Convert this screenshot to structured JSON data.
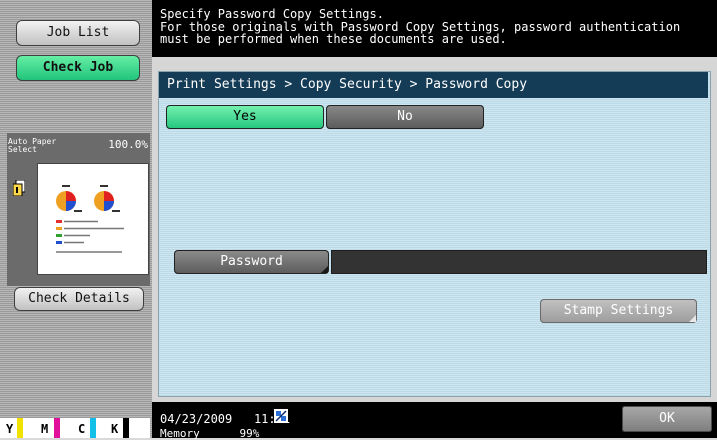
{
  "left": {
    "job_list": "Job List",
    "check_job": "Check Job",
    "paper_label_top": "Auto Paper",
    "paper_label_bottom": "Select",
    "zoom": "100.0%",
    "check_details": "Check Details",
    "toner": [
      "Y",
      "M",
      "C",
      "K"
    ],
    "toner_colors": [
      "#f2e200",
      "#e0109a",
      "#12c0e8",
      "#000000"
    ]
  },
  "header": {
    "message": "Specify Password Copy Settings.\nFor those originals with Password Copy Settings, password authentication\nmust be performed when these documents are used."
  },
  "breadcrumb": "Print Settings > Copy Security > Password Copy",
  "options": {
    "yes": "Yes",
    "no": "No",
    "selected": "Yes"
  },
  "password": {
    "label": "Password",
    "value": ""
  },
  "stamp_settings": "Stamp Settings",
  "status": {
    "date": "04/23/2009",
    "time": "11:21",
    "memory_label": "Memory",
    "memory_value": "99%"
  },
  "ok": "OK",
  "colors": {
    "accent_green": "#2dd48a",
    "breadcrumb_bg": "#153c56",
    "panel_bg": "#c6e0ec"
  }
}
